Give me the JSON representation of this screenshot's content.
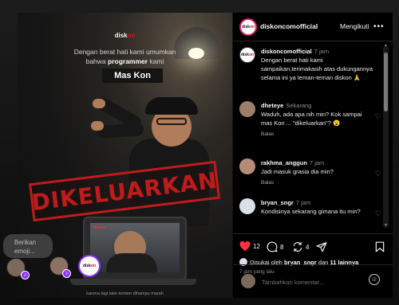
{
  "post_image": {
    "logo_prefix": "disk",
    "logo_suffix": "on",
    "line1": "Dengan berat hati kami umumkan",
    "line2_prefix": "bahwa ",
    "line2_bold": "programmer",
    "line2_suffix": " kami",
    "name_plate": "Mas Kon",
    "stamp": "DIKELUARKAN",
    "caption": "karena lagi take konten dihampu marah",
    "laptop_badge": "diskon"
  },
  "reaction_overlay": {
    "emoji_prompt": "Berikan emoji..."
  },
  "header": {
    "username": "diskoncomofficial",
    "follow_label": "Mengikuti",
    "more_icon": "•••"
  },
  "caption_comment": {
    "username": "diskoncomofficial",
    "time": "7 jam",
    "text": "Dengan berat hati kami sampaikan,terimakasih atas dukungannya selama ini ya teman-teman diskon 🙏"
  },
  "comments": [
    {
      "username": "dheteye",
      "time": "Sekarang",
      "text": "Waduh, ada apa nih min? Kok sampai mas Kon ... \"dikeluarkan\"? 😮",
      "reply_label": "Balas"
    },
    {
      "username": "rakhma_anggun",
      "time": "7 jam",
      "text": "Jadi masuk grasia dia min?",
      "reply_label": "Balas"
    },
    {
      "username": "bryan_sngr",
      "time": "7 jam",
      "text": "Kondisinya sekarang gimana itu min?",
      "reply_label": ""
    }
  ],
  "actions": {
    "like_count": "12",
    "comment_count": "8",
    "repost_count": "4"
  },
  "likes_line": {
    "prefix": "Disukai oleh ",
    "user": "bryan_sngr",
    "middle": " dan ",
    "others": "11 lainnya"
  },
  "post_time": "7 jam yang lalu",
  "composer": {
    "placeholder": "Tambahkan komentar..."
  },
  "colors": {
    "stamp_red": "#c01b1b",
    "brand_ring": "#d6246e",
    "badge_purple": "#8c33ff",
    "like_red": "#ff3040"
  }
}
